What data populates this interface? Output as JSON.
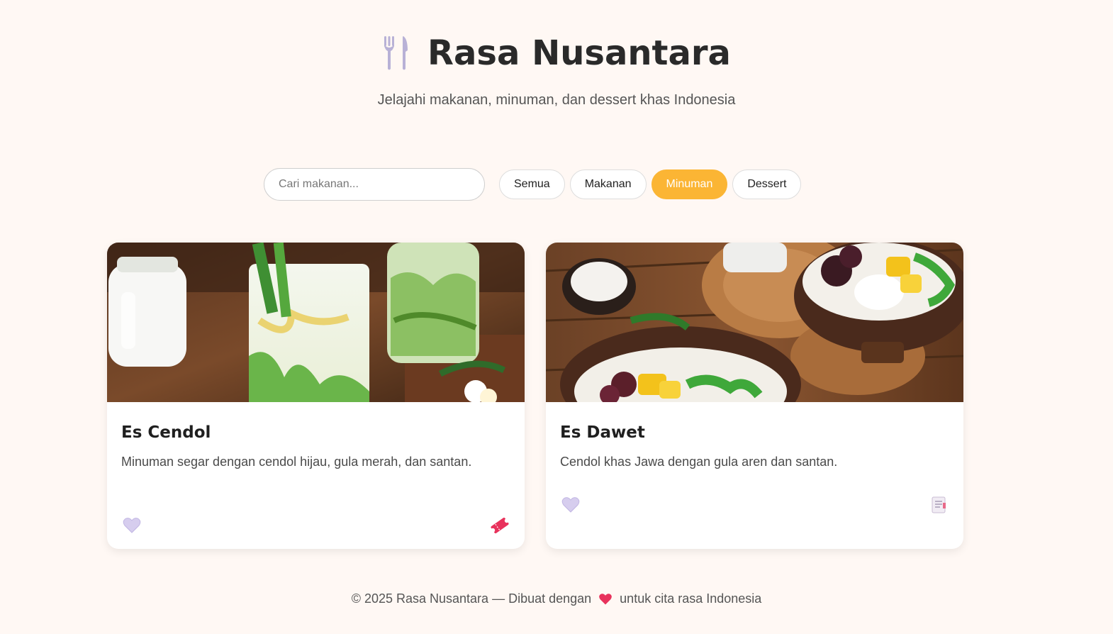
{
  "header": {
    "title": "Rasa Nusantara",
    "subtitle": "Jelajahi makanan, minuman, dan dessert khas Indonesia",
    "logo_icon": "fork-knife-icon"
  },
  "search": {
    "placeholder": "Cari makanan...",
    "value": ""
  },
  "filters": [
    {
      "label": "Semua",
      "active": false
    },
    {
      "label": "Makanan",
      "active": false
    },
    {
      "label": "Minuman",
      "active": true
    },
    {
      "label": "Dessert",
      "active": false
    }
  ],
  "cards": [
    {
      "title": "Es Cendol",
      "description": "Minuman segar dengan cendol hijau, gula merah, dan santan.",
      "like_icon": "heart-icon",
      "action_icon": "ticket-icon"
    },
    {
      "title": "Es Dawet",
      "description": "Cendol khas Jawa dengan gula aren dan santan.",
      "like_icon": "heart-icon",
      "action_icon": "notepad-icon"
    }
  ],
  "footer": {
    "prefix": "© 2025 Rasa Nusantara — Dibuat dengan",
    "suffix": "untuk cita rasa Indonesia"
  },
  "colors": {
    "accent": "#fbb534",
    "background": "#fff8f4",
    "heart_pale": "#c9bfe6",
    "heart_red": "#e8325c"
  }
}
